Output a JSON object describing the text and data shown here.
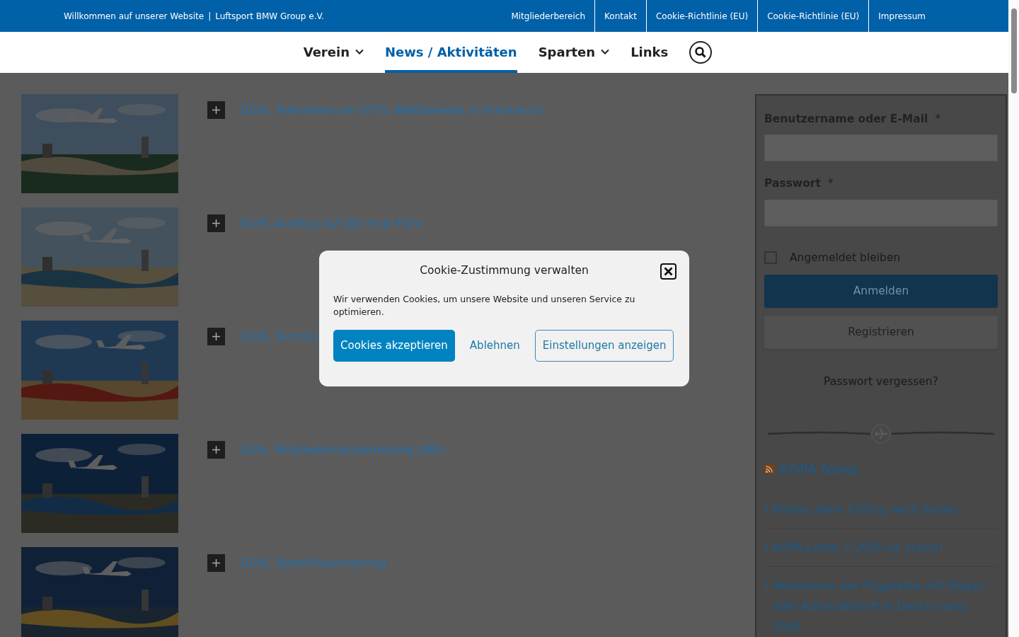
{
  "top_bar": {
    "welcome": "Willkommen auf unserer Website",
    "separator": "|",
    "club": "Luftsport BMW Group e.V.",
    "links": [
      "Mitgliederbereich",
      "Kontakt",
      "Cookie-Richtlinie (EU)",
      "Cookie-Richtlinie (EU)",
      "Impressum"
    ]
  },
  "nav": {
    "items": [
      {
        "label": "Verein",
        "selected": false,
        "has_menu": true
      },
      {
        "label": "News / Aktivitäten",
        "selected": true,
        "has_menu": false
      },
      {
        "label": "Sparten",
        "selected": false,
        "has_menu": true
      },
      {
        "label": "Links",
        "selected": false,
        "has_menu": false
      }
    ]
  },
  "posts": [
    {
      "title": "2026, Teilnahme am STOL Wettbewerb in Frankreich"
    },
    {
      "title": "2026, Ausflug auf die Insel Föhr"
    },
    {
      "title": "2026, Terminü"
    },
    {
      "title": "2026, Mitgliederversammlung (MV)"
    },
    {
      "title": "2026, Sprechfunktraining"
    }
  ],
  "login": {
    "username_label": "Benutzername oder E-Mail",
    "password_label": "Passwort",
    "required_mark": "*",
    "remember": {
      "label": "Angemeldet bleiben",
      "checked": false
    },
    "login_button": "Anmelden",
    "register_button": "Registrieren",
    "forgot_link": "Passwort vergessen?"
  },
  "news": {
    "title": "AOPA News",
    "items": [
      "Risiken beim Einflug nach Italien",
      "AOPA-Letter 2-2026 ist online!",
      "Verzeichnis der Flugplätze mit Mogas oder Autokraftstoff in Deutschland 2026"
    ]
  },
  "cookie_dialog": {
    "title": "Cookie-Zustimmung verwalten",
    "text": "Wir verwenden Cookies, um unsere Website und unseren Service zu optimieren.",
    "accept_button": "Cookies akzeptieren",
    "reject_button": "Ablehnen",
    "settings_button": "Einstellungen anzeigen"
  }
}
